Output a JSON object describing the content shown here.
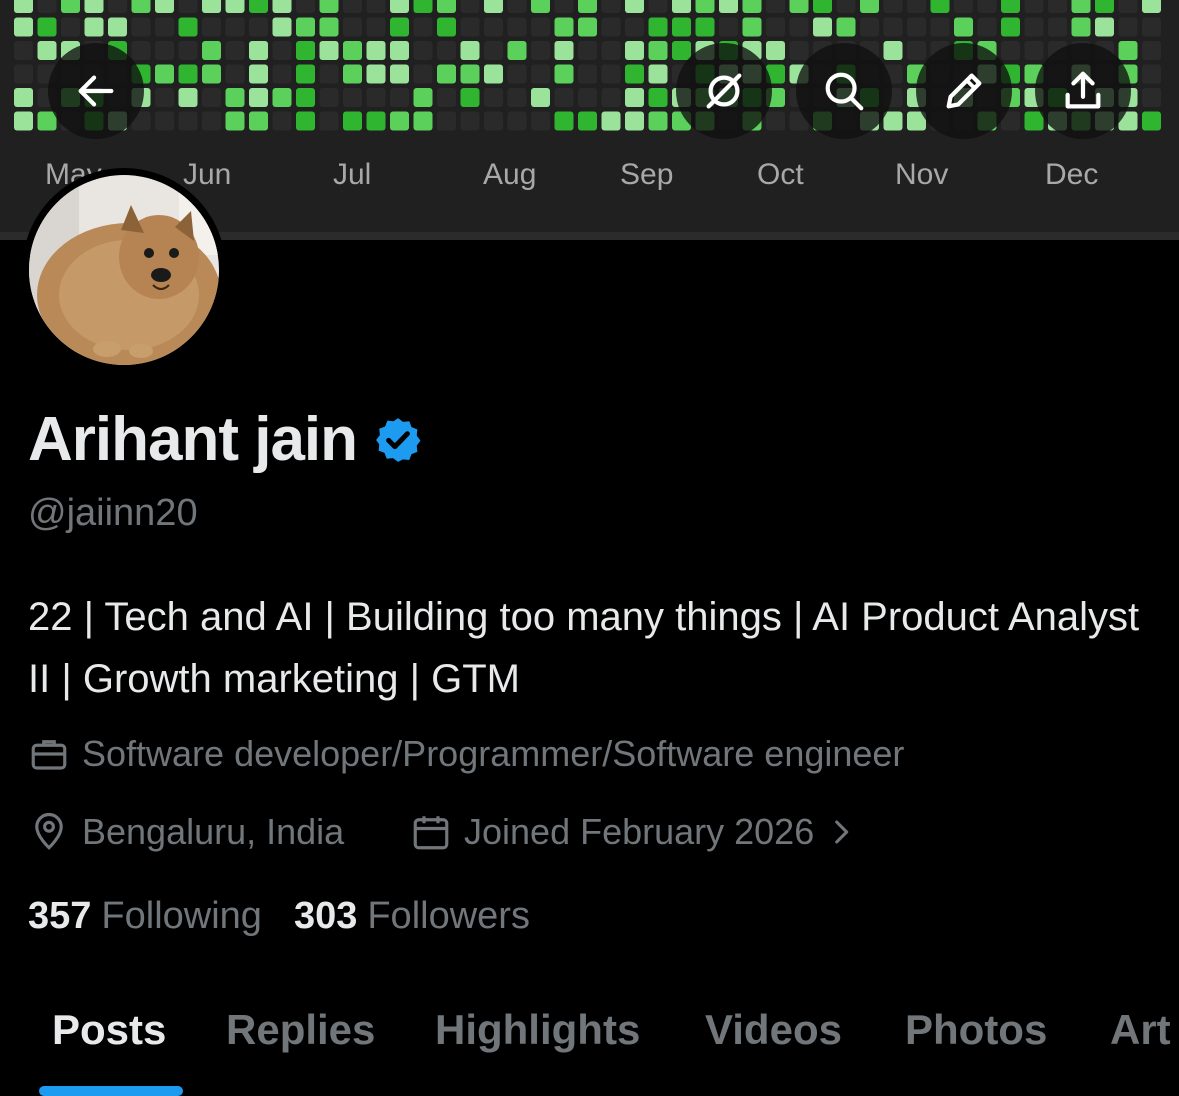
{
  "banner": {
    "months": [
      "May",
      "Jun",
      "Jul",
      "Aug",
      "Sep",
      "Oct",
      "Nov",
      "Dec"
    ],
    "colors": {
      "dark": "#2a2a2a",
      "light": "#9be39b",
      "mid": "#5bd05b",
      "strong": "#2fb52f"
    }
  },
  "toolbar": {
    "back_icon": "arrow-left-icon",
    "grok_icon": "grok-slash-icon",
    "search_icon": "search-icon",
    "edit_icon": "pencil-icon",
    "share_icon": "share-upload-icon"
  },
  "profile": {
    "name": "Arihant jain",
    "handle": "@jaiinn20",
    "verified": true,
    "bio": "22 | Tech and AI | Building too many things | AI Product Analyst II | Growth marketing | GTM",
    "profession": "Software developer/Programmer/Software engineer",
    "location": "Bengaluru, India",
    "joined": "Joined February 2026"
  },
  "stats": {
    "following_count": "357",
    "following_label": "Following",
    "followers_count": "303",
    "followers_label": "Followers"
  },
  "tabs": [
    "Posts",
    "Replies",
    "Highlights",
    "Videos",
    "Photos",
    "Art"
  ],
  "active_tab": "Posts",
  "colors": {
    "accent": "#1d9bf0",
    "text": "#e7e9ea",
    "muted": "#71767b",
    "background": "#000000"
  }
}
